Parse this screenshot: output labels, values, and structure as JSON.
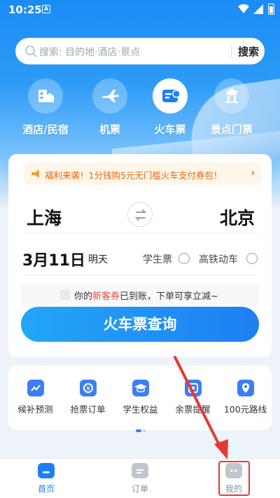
{
  "status_bar": {
    "time": "10:25",
    "notification_badge": "A"
  },
  "search": {
    "placeholder": "搜索: 目的地·酒店·景点",
    "button": "搜索"
  },
  "categories": [
    {
      "label": "酒店/民宿",
      "icon": "hotel-icon"
    },
    {
      "label": "机票",
      "icon": "plane-icon"
    },
    {
      "label": "火车票",
      "icon": "train-ticket-icon",
      "active": true
    },
    {
      "label": "景点门票",
      "icon": "attraction-icon"
    }
  ],
  "booking": {
    "promo_text": "福利来袭！1分钱购5元无门槛火车支付券包！",
    "from_city": "上海",
    "to_city": "北京",
    "date": "3月11日",
    "date_note": "明天",
    "option_student": "学生票",
    "option_highspeed": "高铁动车",
    "coupon_prefix": "你的",
    "coupon_highlight": "新客券",
    "coupon_suffix": "已到账，下单可享立减~",
    "query_button": "火车票查询"
  },
  "quick_actions": [
    {
      "label": "候补预测",
      "icon": "waitlist-chart-icon"
    },
    {
      "label": "抢票订单",
      "icon": "grab-ticket-icon"
    },
    {
      "label": "学生权益",
      "icon": "graduation-cap-icon"
    },
    {
      "label": "余票提醒",
      "icon": "remaining-ticket-icon"
    },
    {
      "label": "100元路线",
      "icon": "route-location-icon"
    }
  ],
  "tabbar": [
    {
      "label": "首页",
      "icon": "home-icon",
      "active": true
    },
    {
      "label": "订单",
      "icon": "orders-icon"
    },
    {
      "label": "我的",
      "icon": "profile-icon"
    }
  ],
  "colors": {
    "primary": "#1e7ff2",
    "promo": "#e06a10",
    "highlight": "#f04a3b",
    "annotation": "#e53935"
  }
}
